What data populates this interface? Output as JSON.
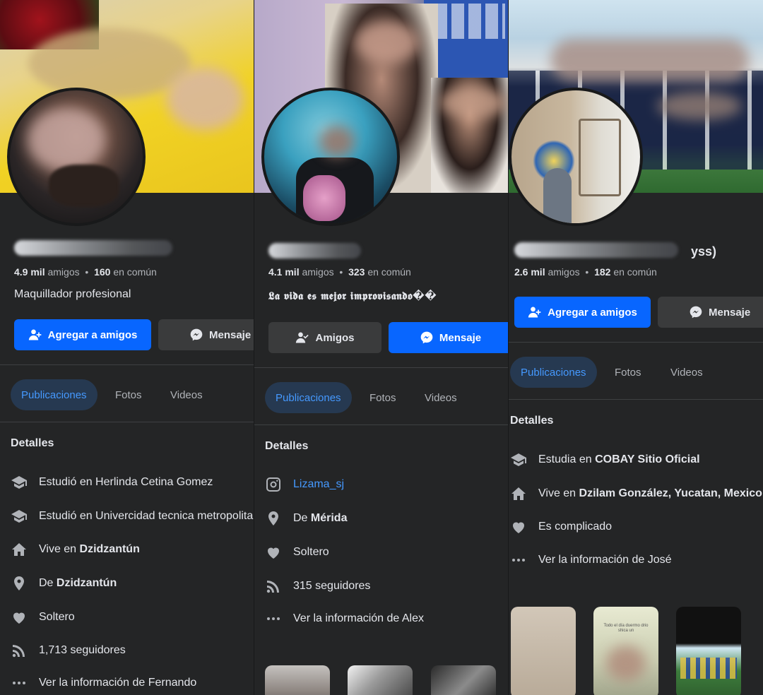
{
  "panels": [
    {
      "stats": {
        "friends_value": "4.9 mil",
        "friends_label": "amigos",
        "mutual_value": "160",
        "mutual_label": "en común"
      },
      "bio": "Maquillador profesional",
      "buttons": {
        "add_friend": "Agregar a amigos",
        "message": "Mensaje"
      },
      "tabs": [
        "Publicaciones",
        "Fotos",
        "Videos"
      ],
      "details_title": "Detalles",
      "details": [
        {
          "icon": "graduation-cap-icon",
          "prefix": "Estudió en Herlinda Cetina Gomez",
          "bold": ""
        },
        {
          "icon": "graduation-cap-icon",
          "prefix": "Estudió en Univercidad tecnica metropolitana",
          "bold": ""
        },
        {
          "icon": "home-icon",
          "prefix": "Vive en ",
          "bold": "Dzidzantún"
        },
        {
          "icon": "location-pin-icon",
          "prefix": "De ",
          "bold": "Dzidzantún"
        },
        {
          "icon": "heart-icon",
          "prefix": "Soltero",
          "bold": ""
        },
        {
          "icon": "rss-icon",
          "prefix": "1,713 seguidores",
          "bold": ""
        },
        {
          "icon": "more-dots-icon",
          "prefix": "Ver la información de Fernando",
          "bold": ""
        }
      ]
    },
    {
      "stats": {
        "friends_value": "4.1 mil",
        "friends_label": "amigos",
        "mutual_value": "323",
        "mutual_label": "en común"
      },
      "bio": "𝕷𝖆 𝖛𝖎𝖉𝖆 𝖊𝖘 𝖒𝖊𝖏𝖔𝖗 𝖎𝖒𝖕𝖗𝖔𝖛𝖎𝖘𝖆𝖓𝖉𝖔��",
      "buttons": {
        "friends": "Amigos",
        "message": "Mensaje"
      },
      "tabs": [
        "Publicaciones",
        "Fotos",
        "Videos"
      ],
      "details_title": "Detalles",
      "details": [
        {
          "icon": "instagram-icon",
          "link": "Lizama_sj"
        },
        {
          "icon": "location-pin-icon",
          "prefix": "De ",
          "bold": "Mérida"
        },
        {
          "icon": "heart-icon",
          "prefix": "Soltero",
          "bold": ""
        },
        {
          "icon": "rss-icon",
          "prefix": "315 seguidores",
          "bold": ""
        },
        {
          "icon": "more-dots-icon",
          "prefix": "Ver la información de Alex",
          "bold": ""
        }
      ]
    },
    {
      "name_suffix": "yss)",
      "stats": {
        "friends_value": "2.6 mil",
        "friends_label": "amigos",
        "mutual_value": "182",
        "mutual_label": "en común"
      },
      "buttons": {
        "add_friend": "Agregar a amigos",
        "message": "Mensaje"
      },
      "tabs": [
        "Publicaciones",
        "Fotos",
        "Videos"
      ],
      "details_title": "Detalles",
      "details": [
        {
          "icon": "graduation-cap-icon",
          "prefix": "Estudia en ",
          "bold": "COBAY Sitio Oficial"
        },
        {
          "icon": "home-icon",
          "prefix": "Vive en ",
          "bold": "Dzilam González, Yucatan, Mexico"
        },
        {
          "icon": "heart-icon",
          "prefix": "Es complicado",
          "bold": ""
        },
        {
          "icon": "more-dots-icon",
          "prefix": "Ver la información de José",
          "bold": ""
        }
      ],
      "story_caption": "Todo el día duermo drio shica un"
    }
  ],
  "colors": {
    "accent": "#0866ff",
    "link": "#4599ff",
    "panel_bg": "#242526",
    "tab_active_bg": "#263951"
  }
}
